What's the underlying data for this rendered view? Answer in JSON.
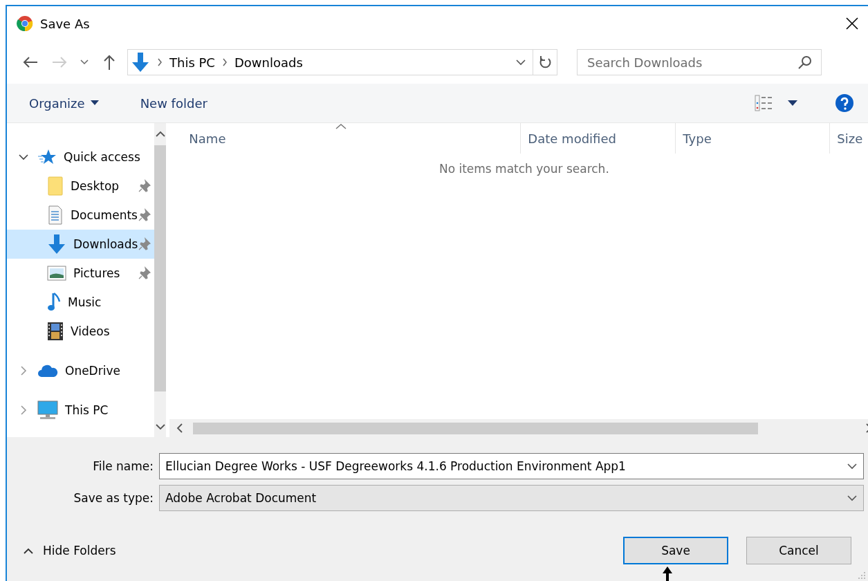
{
  "window": {
    "title": "Save As"
  },
  "navigation": {
    "back_disabled": false,
    "forward_disabled": true
  },
  "address": {
    "breadcrumbs": [
      "This PC",
      "Downloads"
    ]
  },
  "search": {
    "placeholder": "Search Downloads"
  },
  "toolbar": {
    "organize": "Organize",
    "new_folder": "New folder"
  },
  "nav_pane": {
    "items": [
      {
        "label": "Quick access",
        "kind": "star",
        "expanded": true,
        "selected": false,
        "children": [
          {
            "label": "Desktop",
            "kind": "folder",
            "pinned": true,
            "selected": false
          },
          {
            "label": "Documents",
            "kind": "document",
            "pinned": true,
            "selected": false
          },
          {
            "label": "Downloads",
            "kind": "download",
            "pinned": true,
            "selected": true
          },
          {
            "label": "Pictures",
            "kind": "picture",
            "pinned": true,
            "selected": false
          },
          {
            "label": "Music",
            "kind": "music",
            "pinned": false,
            "selected": false
          },
          {
            "label": "Videos",
            "kind": "video",
            "pinned": false,
            "selected": false
          }
        ]
      },
      {
        "label": "OneDrive",
        "kind": "cloud",
        "expanded": false,
        "selected": false
      },
      {
        "label": "This PC",
        "kind": "computer",
        "expanded": false,
        "selected": false
      }
    ]
  },
  "file_list": {
    "columns": [
      {
        "label": "Name",
        "sorted": true
      },
      {
        "label": "Date modified",
        "sorted": false
      },
      {
        "label": "Type",
        "sorted": false
      },
      {
        "label": "Size",
        "sorted": false
      }
    ],
    "empty_message": "No items match your search."
  },
  "form": {
    "file_name_label": "File name:",
    "file_name": "Ellucian Degree Works - USF Degreeworks 4.1.6 Production Environment App1",
    "type_label": "Save as type:",
    "type": "Adobe Acrobat Document"
  },
  "footer": {
    "hide_folders": "Hide Folders",
    "buttons": [
      {
        "label": "Save",
        "default": true
      },
      {
        "label": "Cancel",
        "default": false
      }
    ]
  }
}
